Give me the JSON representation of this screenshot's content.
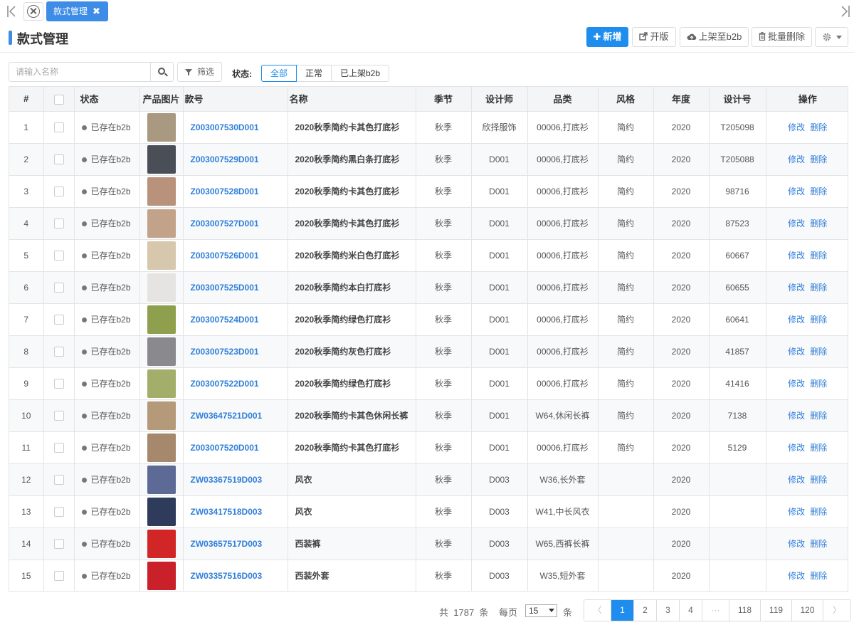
{
  "tabs": {
    "active_label": "款式管理",
    "close_glyph": "✖"
  },
  "header": {
    "title": "款式管理",
    "buttons": {
      "add": "新增",
      "open_version": "开版",
      "list_b2b": "上架至b2b",
      "batch_delete": "批量删除"
    }
  },
  "filters": {
    "search_placeholder": "请输入名称",
    "filter_label": "筛选",
    "status_label": "状态:",
    "status_options": [
      "全部",
      "正常",
      "已上架b2b"
    ],
    "status_selected": "全部"
  },
  "table": {
    "columns": [
      "#",
      "",
      "状态",
      "产品图片",
      "款号",
      "名称",
      "季节",
      "设计师",
      "品类",
      "风格",
      "年度",
      "设计号",
      "操作"
    ],
    "action_edit": "修改",
    "action_delete": "删除",
    "rows": [
      {
        "no": "1",
        "status": "已存在b2b",
        "thumb": "#a89980",
        "code": "Z003007530D001",
        "name": "2020秋季简约卡其色打底衫",
        "season": "秋季",
        "designer": "欣择服饰",
        "category": "00006,打底衫",
        "style": "简约",
        "year": "2020",
        "design_no": "T205098"
      },
      {
        "no": "2",
        "status": "已存在b2b",
        "thumb": "#4a4f57",
        "code": "Z003007529D001",
        "name": "2020秋季简约黑白条打底衫",
        "season": "秋季",
        "designer": "D001",
        "category": "00006,打底衫",
        "style": "简约",
        "year": "2020",
        "design_no": "T205088"
      },
      {
        "no": "3",
        "status": "已存在b2b",
        "thumb": "#b8927b",
        "code": "Z003007528D001",
        "name": "2020秋季简约卡其色打底衫",
        "season": "秋季",
        "designer": "D001",
        "category": "00006,打底衫",
        "style": "简约",
        "year": "2020",
        "design_no": "98716"
      },
      {
        "no": "4",
        "status": "已存在b2b",
        "thumb": "#c2a288",
        "code": "Z003007527D001",
        "name": "2020秋季简约卡其色打底衫",
        "season": "秋季",
        "designer": "D001",
        "category": "00006,打底衫",
        "style": "简约",
        "year": "2020",
        "design_no": "87523"
      },
      {
        "no": "5",
        "status": "已存在b2b",
        "thumb": "#d6c7ad",
        "code": "Z003007526D001",
        "name": "2020秋季简约米白色打底衫",
        "season": "秋季",
        "designer": "D001",
        "category": "00006,打底衫",
        "style": "简约",
        "year": "2020",
        "design_no": "60667"
      },
      {
        "no": "6",
        "status": "已存在b2b",
        "thumb": "#e6e4e2",
        "code": "Z003007525D001",
        "name": "2020秋季简约本白打底衫",
        "season": "秋季",
        "designer": "D001",
        "category": "00006,打底衫",
        "style": "简约",
        "year": "2020",
        "design_no": "60655"
      },
      {
        "no": "7",
        "status": "已存在b2b",
        "thumb": "#8ea04e",
        "code": "Z003007524D001",
        "name": "2020秋季简约绿色打底衫",
        "season": "秋季",
        "designer": "D001",
        "category": "00006,打底衫",
        "style": "简约",
        "year": "2020",
        "design_no": "60641"
      },
      {
        "no": "8",
        "status": "已存在b2b",
        "thumb": "#8a8a8e",
        "code": "Z003007523D001",
        "name": "2020秋季简约灰色打底衫",
        "season": "秋季",
        "designer": "D001",
        "category": "00006,打底衫",
        "style": "简约",
        "year": "2020",
        "design_no": "41857"
      },
      {
        "no": "9",
        "status": "已存在b2b",
        "thumb": "#a3ae6a",
        "code": "Z003007522D001",
        "name": "2020秋季简约绿色打底衫",
        "season": "秋季",
        "designer": "D001",
        "category": "00006,打底衫",
        "style": "简约",
        "year": "2020",
        "design_no": "41416"
      },
      {
        "no": "10",
        "status": "已存在b2b",
        "thumb": "#b59a7a",
        "code": "ZW03647521D001",
        "name": "2020秋季简约卡其色休闲长裤",
        "season": "秋季",
        "designer": "D001",
        "category": "W64,休闲长裤",
        "style": "简约",
        "year": "2020",
        "design_no": "7138"
      },
      {
        "no": "11",
        "status": "已存在b2b",
        "thumb": "#a6896d",
        "code": "Z003007520D001",
        "name": "2020秋季简约卡其色打底衫",
        "season": "秋季",
        "designer": "D001",
        "category": "00006,打底衫",
        "style": "简约",
        "year": "2020",
        "design_no": "5129"
      },
      {
        "no": "12",
        "status": "已存在b2b",
        "thumb": "#5d6a95",
        "code": "ZW03367519D003",
        "name": "风衣",
        "season": "秋季",
        "designer": "D003",
        "category": "W36,长外套",
        "style": "",
        "year": "2020",
        "design_no": ""
      },
      {
        "no": "13",
        "status": "已存在b2b",
        "thumb": "#2e3b5a",
        "code": "ZW03417518D003",
        "name": "风衣",
        "season": "秋季",
        "designer": "D003",
        "category": "W41,中长风衣",
        "style": "",
        "year": "2020",
        "design_no": ""
      },
      {
        "no": "14",
        "status": "已存在b2b",
        "thumb": "#d22626",
        "code": "ZW03657517D003",
        "name": "西装裤",
        "season": "秋季",
        "designer": "D003",
        "category": "W65,西裤长裤",
        "style": "",
        "year": "2020",
        "design_no": ""
      },
      {
        "no": "15",
        "status": "已存在b2b",
        "thumb": "#c9202a",
        "code": "ZW03357516D003",
        "name": "西装外套",
        "season": "秋季",
        "designer": "D003",
        "category": "W35,短外套",
        "style": "",
        "year": "2020",
        "design_no": ""
      }
    ]
  },
  "pagination": {
    "total_prefix": "共",
    "total_count": "1787",
    "total_suffix": "条",
    "per_page_label": "每页",
    "per_page_value": "15",
    "per_page_unit": "条",
    "pages": [
      "〈",
      "1",
      "2",
      "3",
      "4",
      "···",
      "118",
      "119",
      "120",
      "〉"
    ],
    "current": "1"
  },
  "colors": {
    "accent": "#1f8ded",
    "link": "#2f7fd8"
  }
}
